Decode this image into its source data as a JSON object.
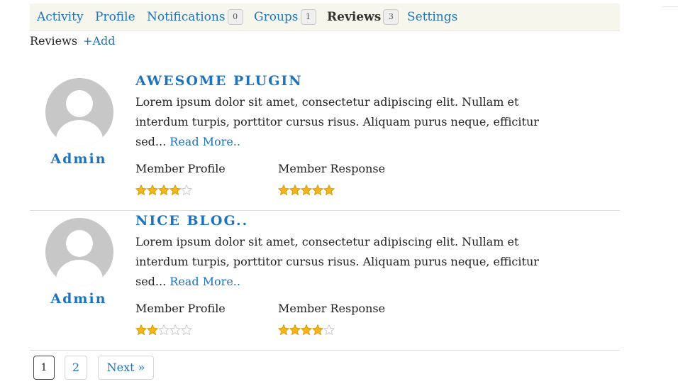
{
  "nav": {
    "items": [
      {
        "label": "Activity",
        "count": ""
      },
      {
        "label": "Profile",
        "count": ""
      },
      {
        "label": "Notifications",
        "count": "0"
      },
      {
        "label": "Groups",
        "count": "1"
      },
      {
        "label": "Reviews",
        "count": "3"
      },
      {
        "label": "Settings",
        "count": ""
      }
    ]
  },
  "subnav": {
    "label": "Reviews",
    "add_label": "+Add"
  },
  "reviews": [
    {
      "author": "Admin",
      "title": "AWESOME PLUGIN",
      "excerpt": "Lorem ipsum dolor sit amet, consectetur adipiscing elit. Nullam et interdum turpis, porttitor cursus risus. Aliquam purus neque, efficitur sed...",
      "read_more": "Read More..",
      "ratings": [
        {
          "label": "Member Profile",
          "stars": 4,
          "max": 5
        },
        {
          "label": "Member Response",
          "stars": 5,
          "max": 5
        }
      ]
    },
    {
      "author": "Admin",
      "title": "NICE BLOG..",
      "excerpt": "Lorem ipsum dolor sit amet, consectetur adipiscing elit. Nullam et interdum turpis, porttitor cursus risus. Aliquam purus neque, efficitur sed...",
      "read_more": "Read More..",
      "ratings": [
        {
          "label": "Member Profile",
          "stars": 2,
          "max": 5
        },
        {
          "label": "Member Response",
          "stars": 4,
          "max": 5
        }
      ]
    }
  ],
  "pagination": {
    "pages": [
      "1",
      "2"
    ],
    "current": "1",
    "next_label": "Next »"
  },
  "colors": {
    "link": "#1e73be",
    "star_filled": "#f6b518",
    "star_empty": "#cccccc",
    "nav_bg": "#f7f6ec"
  },
  "icons": {
    "avatar": "default-user-avatar-icon",
    "star": "star-icon"
  }
}
